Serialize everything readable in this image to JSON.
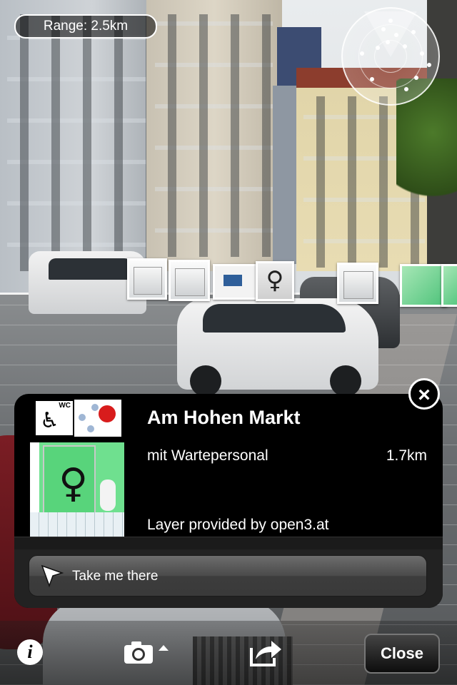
{
  "hud": {
    "range_label": "Range: 2.5km"
  },
  "card": {
    "title": "Am Hohen Markt",
    "subtitle": "mit Wartepersonal",
    "distance": "1.7km",
    "provider": "Layer provided by open3.at",
    "icon_wc_label": "WC",
    "navigate_label": "Take me there"
  },
  "toolbar": {
    "info_label": "i",
    "close_label": "Close"
  },
  "icons": {
    "info": "info-icon",
    "camera": "camera-icon",
    "share": "share-icon",
    "close_card": "close-circle-icon",
    "navigate": "cursor-arrow-icon",
    "radar": "radar-icon"
  },
  "colors": {
    "card_bg": "#000000",
    "stop_sign": "#d81c1c",
    "poi_green": "#4fc37b"
  }
}
